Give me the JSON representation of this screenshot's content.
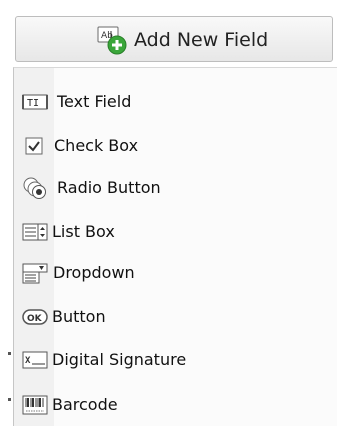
{
  "header": {
    "add_label": "Add New Field"
  },
  "menu": {
    "items": [
      {
        "label": "Text Field",
        "icon": "text-field-icon"
      },
      {
        "label": "Check Box",
        "icon": "checkbox-icon"
      },
      {
        "label": "Radio Button",
        "icon": "radio-button-icon"
      },
      {
        "label": "List Box",
        "icon": "list-box-icon"
      },
      {
        "label": "Dropdown",
        "icon": "dropdown-icon"
      },
      {
        "label": "Button",
        "icon": "button-icon"
      },
      {
        "label": "Digital Signature",
        "icon": "digital-signature-icon"
      },
      {
        "label": "Barcode",
        "icon": "barcode-icon"
      }
    ]
  },
  "colors": {
    "accent_green": "#3aa63a",
    "icon_gray": "#666666"
  }
}
